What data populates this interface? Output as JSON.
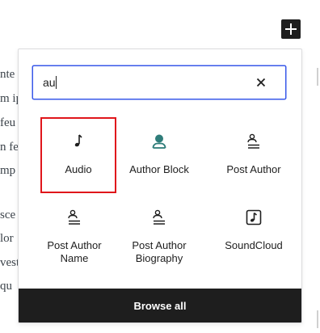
{
  "background_text": {
    "lines": [
      "nte",
      "m ip",
      "feu",
      "n fe",
      "mp",
      "sce",
      "lor",
      "vest",
      "qu"
    ]
  },
  "add_block_button": {
    "icon": "plus-icon"
  },
  "inserter": {
    "search": {
      "value": "au",
      "placeholder": "Search"
    },
    "clear_icon": "close-icon",
    "blocks": [
      {
        "label": "Audio",
        "icon": "audio-icon",
        "selected": true
      },
      {
        "label": "Author Block",
        "icon": "user-icon",
        "accent": "#2f7d7a"
      },
      {
        "label": "Post Author",
        "icon": "post-author-icon"
      },
      {
        "label": "Post Author Name",
        "icon": "post-author-icon"
      },
      {
        "label": "Post Author Biography",
        "icon": "post-author-icon"
      },
      {
        "label": "SoundCloud",
        "icon": "soundcloud-icon"
      }
    ],
    "browse_all_label": "Browse all"
  },
  "colors": {
    "accent": "#3858e9",
    "selection": "#e0161b",
    "dark": "#1e1e1e"
  }
}
